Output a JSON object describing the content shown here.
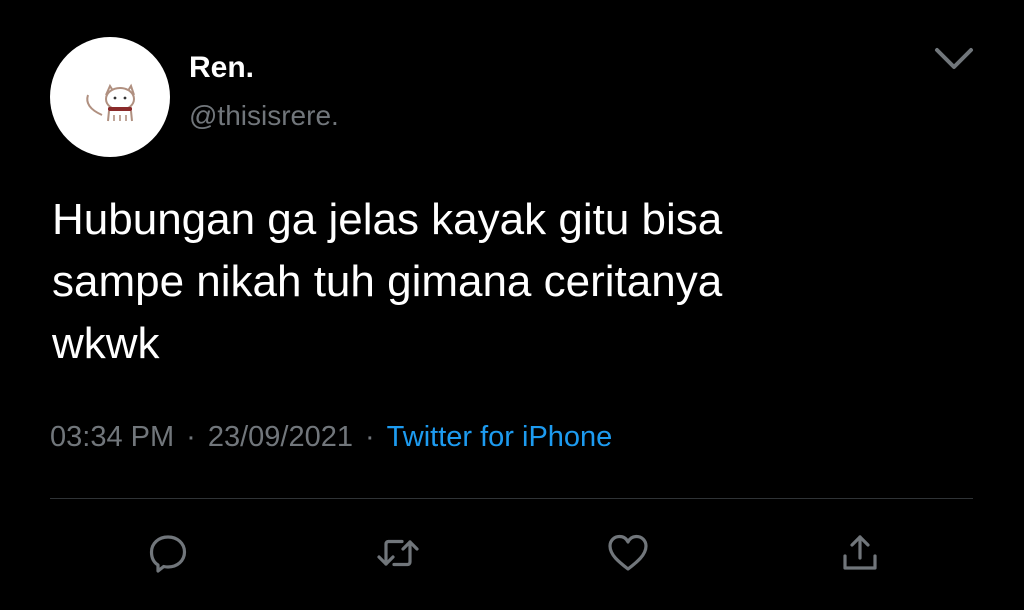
{
  "tweet": {
    "author": {
      "name": "Ren.",
      "handle": "@thisisrere."
    },
    "text_lines": [
      "Hubungan ga jelas kayak gitu bisa",
      "sampe nikah tuh gimana ceritanya",
      "wkwk"
    ],
    "time": "03:34 PM",
    "separator": "·",
    "date": "23/09/2021",
    "source": "Twitter for iPhone"
  },
  "icons": {
    "menu": "chevron-down-icon",
    "reply": "reply-icon",
    "retweet": "retweet-icon",
    "like": "heart-icon",
    "share": "share-icon"
  },
  "colors": {
    "background": "#000000",
    "primary_text": "#ffffff",
    "secondary_text": "#71767b",
    "link": "#1d9bf0",
    "divider": "#2f3336"
  }
}
